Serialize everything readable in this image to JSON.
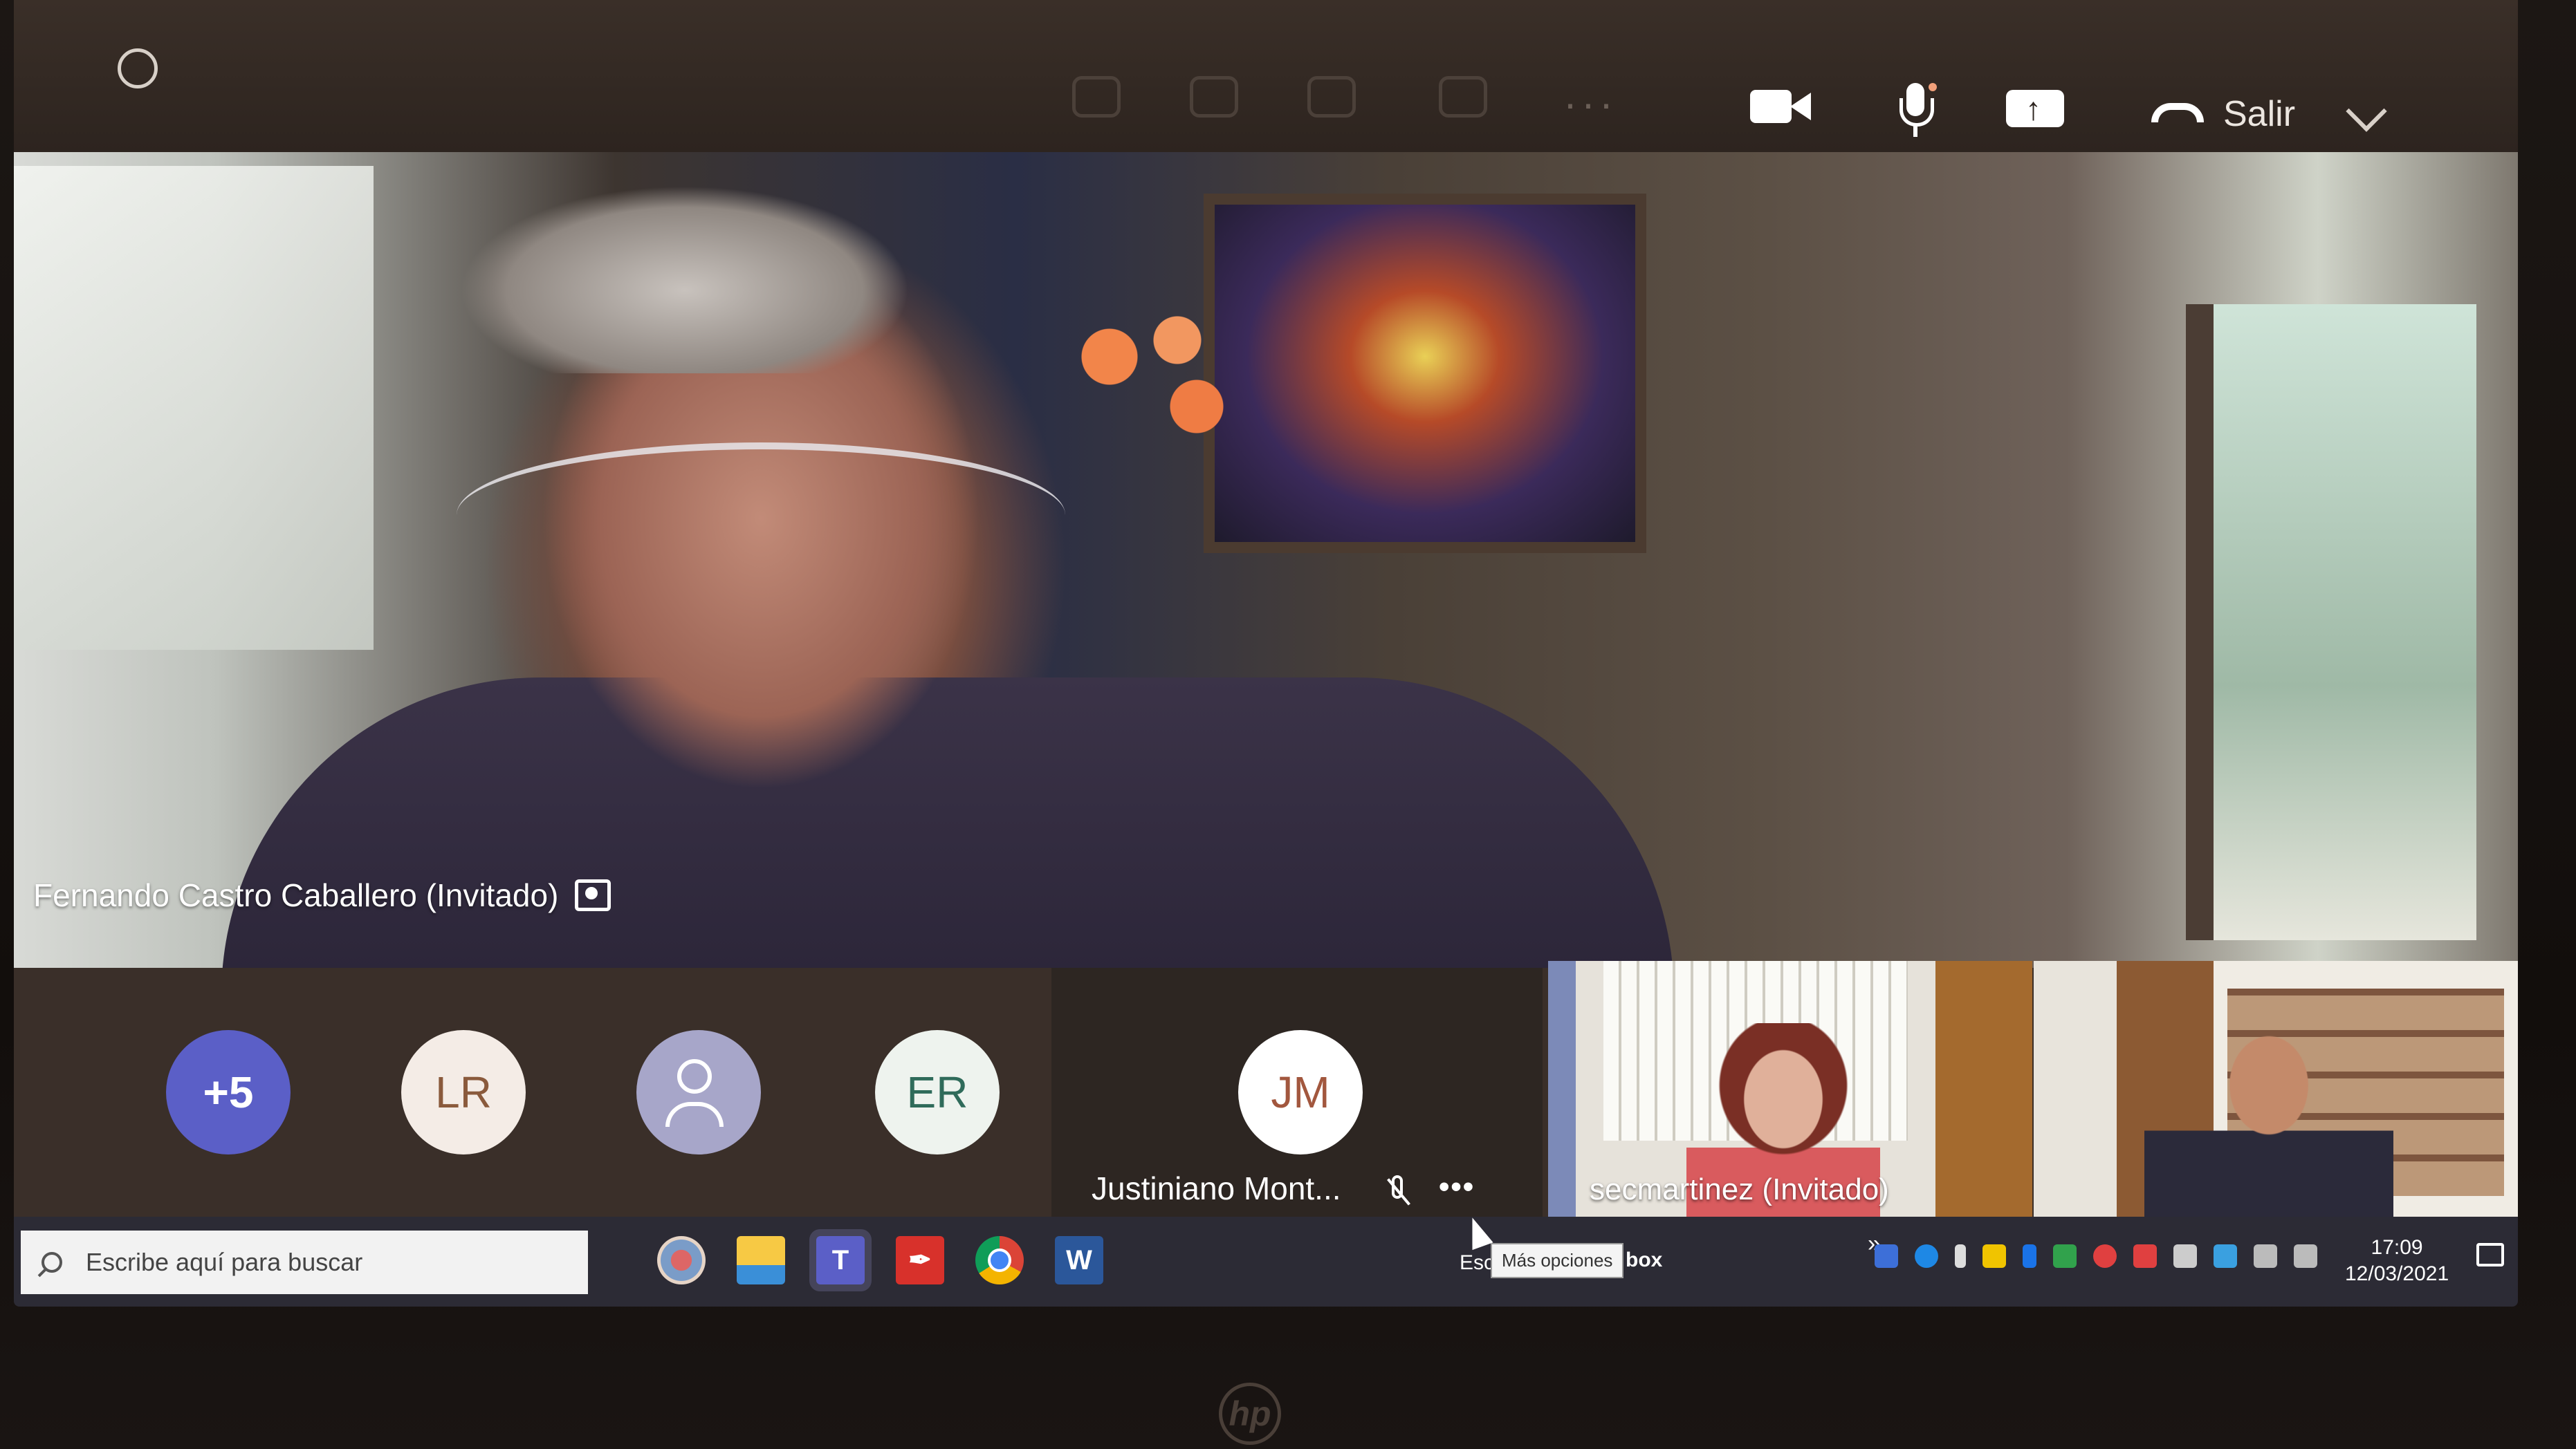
{
  "call_controls": {
    "leave_label": "Salir"
  },
  "main_video": {
    "speaker_name": "Fernando Castro Caballero (Invitado)"
  },
  "participants": {
    "overflow_count": "+5",
    "avatars": [
      {
        "initials": "LR"
      },
      {
        "initials": ""
      },
      {
        "initials": "ER"
      }
    ],
    "jm": {
      "initials": "JM",
      "name": "Justiniano Mont...",
      "more_options": "•••"
    },
    "video_a": {
      "name": "secmartinez (Invitado)"
    }
  },
  "taskbar": {
    "search_placeholder": "Escribe aquí para buscar",
    "teams_label": "T",
    "word_label": "W",
    "fragment_left": "Esc",
    "fragment_right": "box",
    "tooltip": "Más opciones",
    "tray_chevron": "»",
    "time": "17:09",
    "date": "12/03/2021"
  },
  "brand": {
    "logo": "hp"
  },
  "colors": {
    "teams_accent": "#5b5fc7",
    "toolbar_bg": "#2d241f",
    "taskbar_bg": "#2c2b35"
  }
}
